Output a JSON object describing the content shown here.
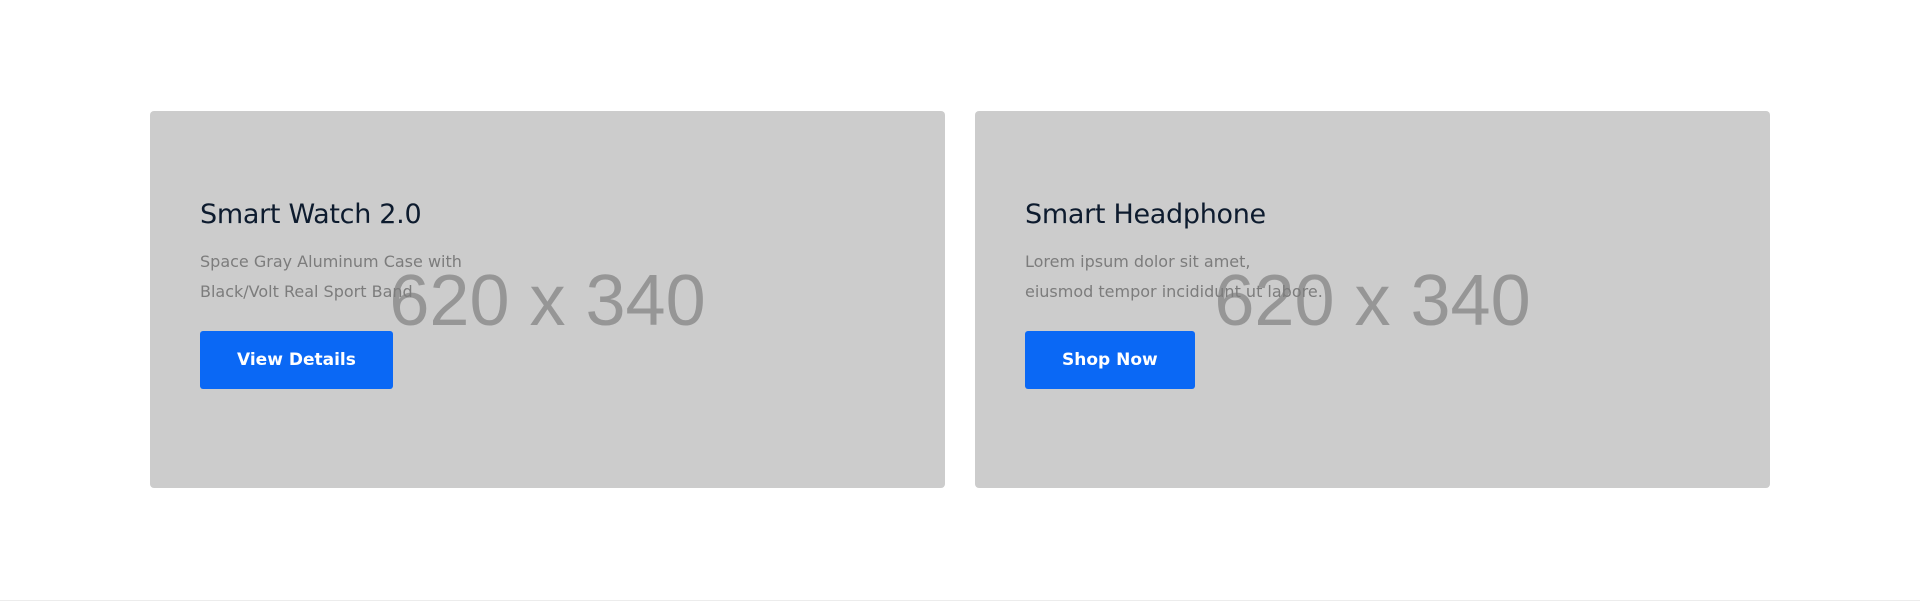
{
  "banners": [
    {
      "title": "Smart Watch 2.0",
      "description_lines": [
        "Space Gray Aluminum Case with",
        "Black/Volt Real Sport Band"
      ],
      "button_label": "View Details",
      "placeholder": "620 x 340"
    },
    {
      "title": "Smart Headphone",
      "description_lines": [
        "Lorem ipsum dolor sit amet,",
        "eiusmod tempor incididunt ut labore."
      ],
      "button_label": "Shop Now",
      "placeholder": "620 x 340"
    }
  ],
  "colors": {
    "banner_background": "#cccccc",
    "button_background": "#0a68f5",
    "title_text": "#0d1b2e",
    "description_text": "#7c7c7c",
    "placeholder_text": "#969696"
  }
}
